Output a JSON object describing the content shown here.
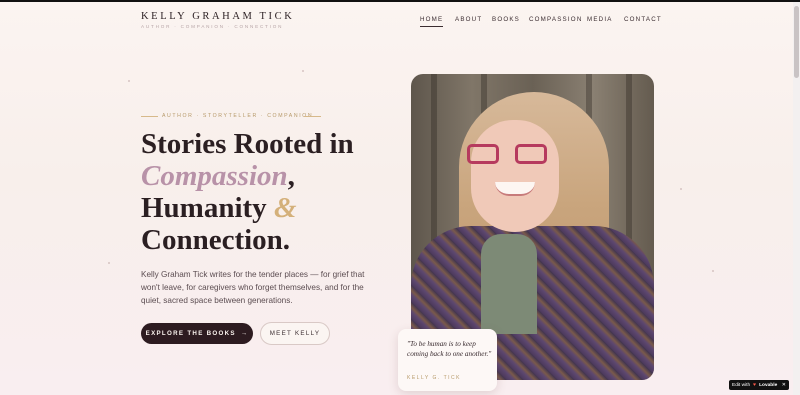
{
  "header": {
    "brand_name": "KELLY GRAHAM TICK",
    "brand_tagline": "AUTHOR · COMPANION · CONNECTION",
    "nav": [
      "HOME",
      "ABOUT",
      "BOOKS",
      "COMPASSION",
      "MEDIA",
      "CONTACT"
    ],
    "active_nav": "HOME"
  },
  "hero": {
    "eyebrow": "AUTHOR · STORYTELLER · COMPANION",
    "headline": {
      "line1": "Stories Rooted in",
      "accent": "Compassion",
      "comma": ",",
      "line3_start": "Humanity ",
      "ampersand": "&",
      "line4": "Connection."
    },
    "body": "Kelly Graham Tick writes for the tender places — for grief that won't leave, for caregivers who forget themselves, and for the quiet, sacred space between generations.",
    "primary_button": "EXPLORE THE BOOKS",
    "primary_button_arrow": "→",
    "secondary_button": "MEET KELLY"
  },
  "quote": {
    "text": "\"To be human is to keep coming back to one another.\"",
    "author": "KELLY G. TICK"
  },
  "badge": {
    "prefix": "Edit with",
    "heart": "♥",
    "brand": "Lovable",
    "close": "✕"
  },
  "colors": {
    "accent_pink": "#b892a8",
    "accent_gold": "#d4b07a",
    "dark": "#2d1b20"
  }
}
